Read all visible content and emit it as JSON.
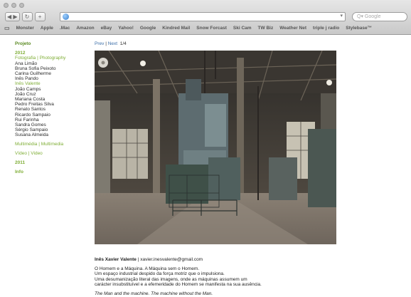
{
  "browser": {
    "search_placeholder": "Google",
    "bookmarks": [
      "Monster",
      "Apple",
      ".Mac",
      "Amazon",
      "eBay",
      "Yahoo!",
      "Google",
      "Kindred Mail",
      "Snow Forcast",
      "Ski Cam",
      "TW Biz",
      "Weather Net",
      "triple j radio",
      "Stylebase™"
    ]
  },
  "sidebar": {
    "heading": "Projeto",
    "year_2012": "2012",
    "category_photo": "Fotografia | Photography",
    "students": [
      "Ana Limão",
      "Bruna Sofia Peixoto",
      "Carina Guilherme",
      "Inês Pando",
      "Inês Valente",
      "João Camps",
      "João Cruz",
      "Mariana Costa",
      "Pedro Freitas Silva",
      "Renato Santos",
      "Ricardo Sampaio",
      "Rui Farinha",
      "Sandra Gomes",
      "Sérgio Sampaio",
      "Susana Almeida"
    ],
    "active_student": "Inês Valente",
    "category_multimedia": "Multimédia | Multimedia",
    "category_video": "Vídeo | Video",
    "year_2011": "2011",
    "info": "Info"
  },
  "pager": {
    "prev": "Prev",
    "separator": "|",
    "next": "Next",
    "count": "1/4"
  },
  "caption": {
    "author": "Inês Xavier Valente",
    "email": " | xavier.inesvalente@gmail.com",
    "pt_lines": [
      "O Homem e a Máquina. A Máquina sem o Homem.",
      "Um espaço industrial despido da força motriz que o impulsiona.",
      "Uma desumanização literal das imagens, onde as máquinas assumem um",
      "carácter insubstituível e a efemeridade do Homem se manifesta na sua ausência."
    ],
    "en_line": "The Man and the machine. The machine without the Man."
  }
}
